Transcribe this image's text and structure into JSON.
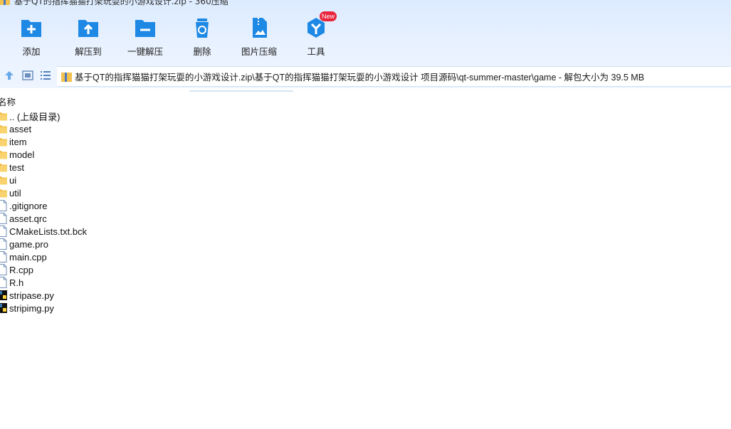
{
  "window": {
    "title": "基于QT的指挥猫猫打架玩耍的小游戏设计.zip - 360压缩"
  },
  "toolbar": {
    "buttons": [
      {
        "label": "添加",
        "icon": "add-folder-icon"
      },
      {
        "label": "解压到",
        "icon": "extract-to-icon"
      },
      {
        "label": "一键解压",
        "icon": "one-click-extract-icon"
      },
      {
        "label": "删除",
        "icon": "recycle-bin-icon"
      },
      {
        "label": "图片压缩",
        "icon": "image-compress-icon"
      },
      {
        "label": "工具",
        "icon": "tools-icon"
      }
    ],
    "tools_badge": "New"
  },
  "nav": {
    "address": "基于QT的指挥猫猫打架玩耍的小游戏设计.zip\\基于QT的指挥猫猫打架玩耍的小游戏设计 项目源码\\qt-summer-master\\game - 解包大小为 39.5 MB"
  },
  "list": {
    "column_name": "名称",
    "items": [
      {
        "name": ".. (上级目录)",
        "type": "folder"
      },
      {
        "name": "asset",
        "type": "folder"
      },
      {
        "name": "item",
        "type": "folder"
      },
      {
        "name": "model",
        "type": "folder"
      },
      {
        "name": "test",
        "type": "folder"
      },
      {
        "name": "ui",
        "type": "folder"
      },
      {
        "name": "util",
        "type": "folder"
      },
      {
        "name": ".gitignore",
        "type": "file"
      },
      {
        "name": "asset.qrc",
        "type": "file"
      },
      {
        "name": "CMakeLists.txt.bck",
        "type": "file"
      },
      {
        "name": "game.pro",
        "type": "file"
      },
      {
        "name": "main.cpp",
        "type": "file"
      },
      {
        "name": "R.cpp",
        "type": "file"
      },
      {
        "name": "R.h",
        "type": "file"
      },
      {
        "name": "stripase.py",
        "type": "python"
      },
      {
        "name": "stripimg.py",
        "type": "python"
      }
    ]
  },
  "colors": {
    "accent": "#1e88e5",
    "badge": "#e8243b",
    "toolbar_bg": "#e3eefc"
  }
}
